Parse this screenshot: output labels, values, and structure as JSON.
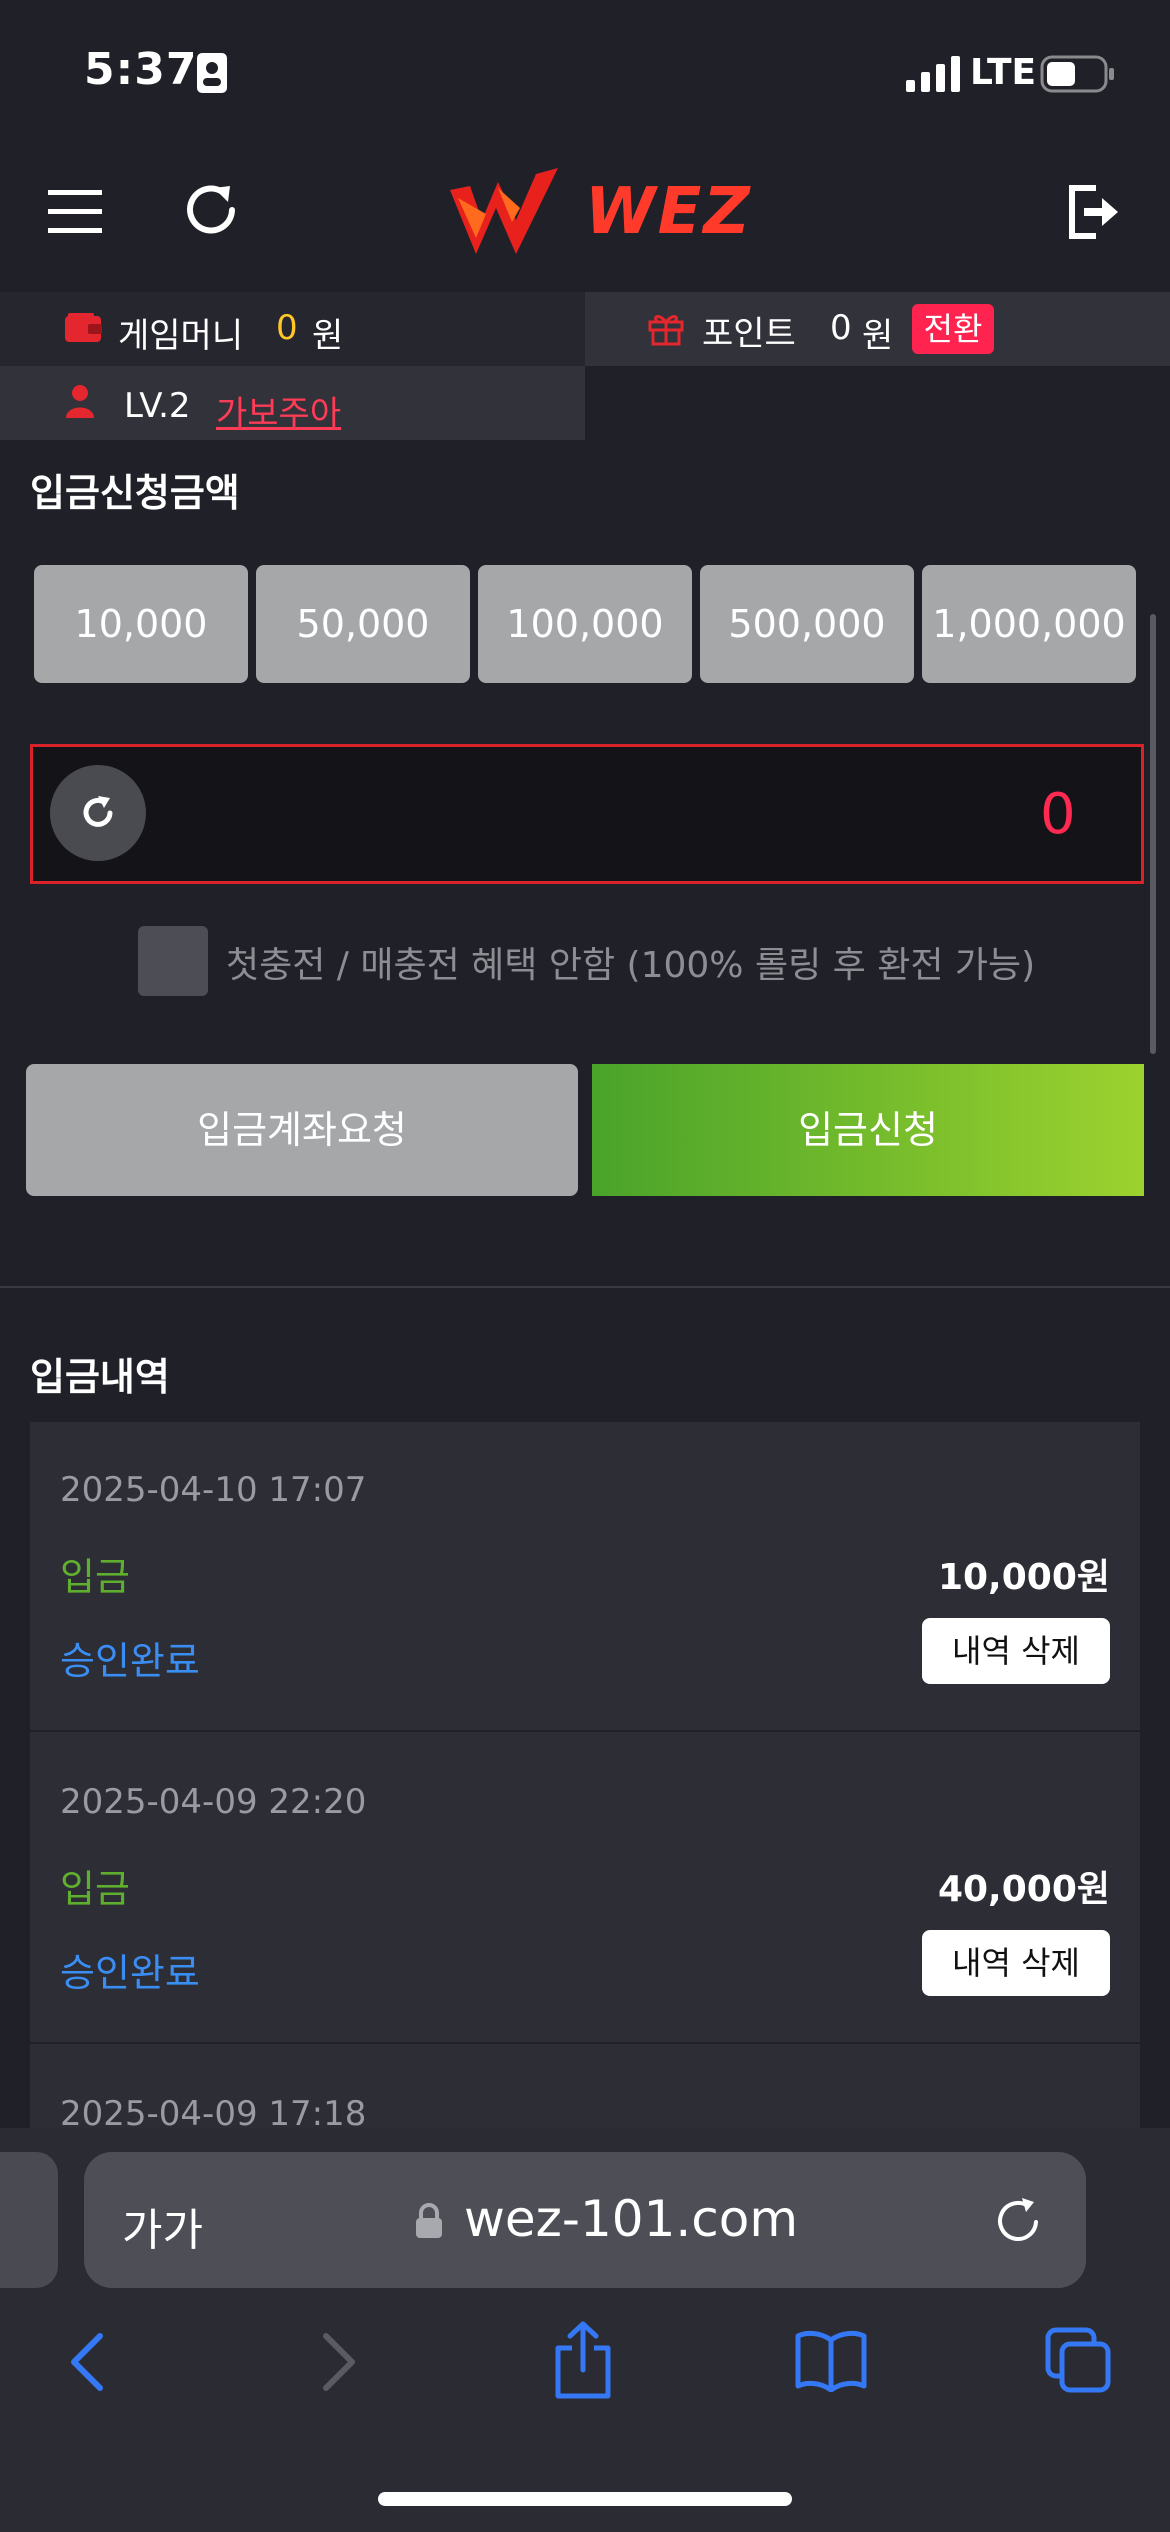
{
  "status_bar": {
    "time": "5:37",
    "network": "LTE"
  },
  "header": {
    "logo_text": "WEZ"
  },
  "info": {
    "game_money_label": "게임머니",
    "game_money_value": "0",
    "game_money_unit": "원",
    "points_label": "포인트",
    "points_value": "0",
    "points_unit": "원",
    "convert_button": "전환",
    "level": "LV.2",
    "username": "가보주아"
  },
  "deposit": {
    "title": "입금신청금액",
    "quick_amounts": [
      "10,000",
      "50,000",
      "100,000",
      "500,000",
      "1,000,000"
    ],
    "amount_value": "0",
    "bonus_checkbox_label": "첫충전 / 매충전 혜택 안함 (100% 롤링 후 환전 가능)",
    "request_account_button": "입금계좌요청",
    "request_deposit_button": "입금신청"
  },
  "history": {
    "title": "입금내역",
    "items": [
      {
        "date": "2025-04-10 17:07",
        "type": "입금",
        "amount": "10,000원",
        "status": "승인완료",
        "delete_button": "내역 삭제"
      },
      {
        "date": "2025-04-09 22:20",
        "type": "입금",
        "amount": "40,000원",
        "status": "승인완료",
        "delete_button": "내역 삭제"
      },
      {
        "date": "2025-04-09 17:18"
      }
    ]
  },
  "browser": {
    "text_size_label": "가가",
    "url": "wez-101.com"
  },
  "colors": {
    "background": "#202128",
    "accent_red": "#ff2450",
    "gold": "#ffc629",
    "deposit_green": "#5fae2e",
    "status_blue": "#3a8ef2",
    "ios_blue": "#3478f6"
  }
}
